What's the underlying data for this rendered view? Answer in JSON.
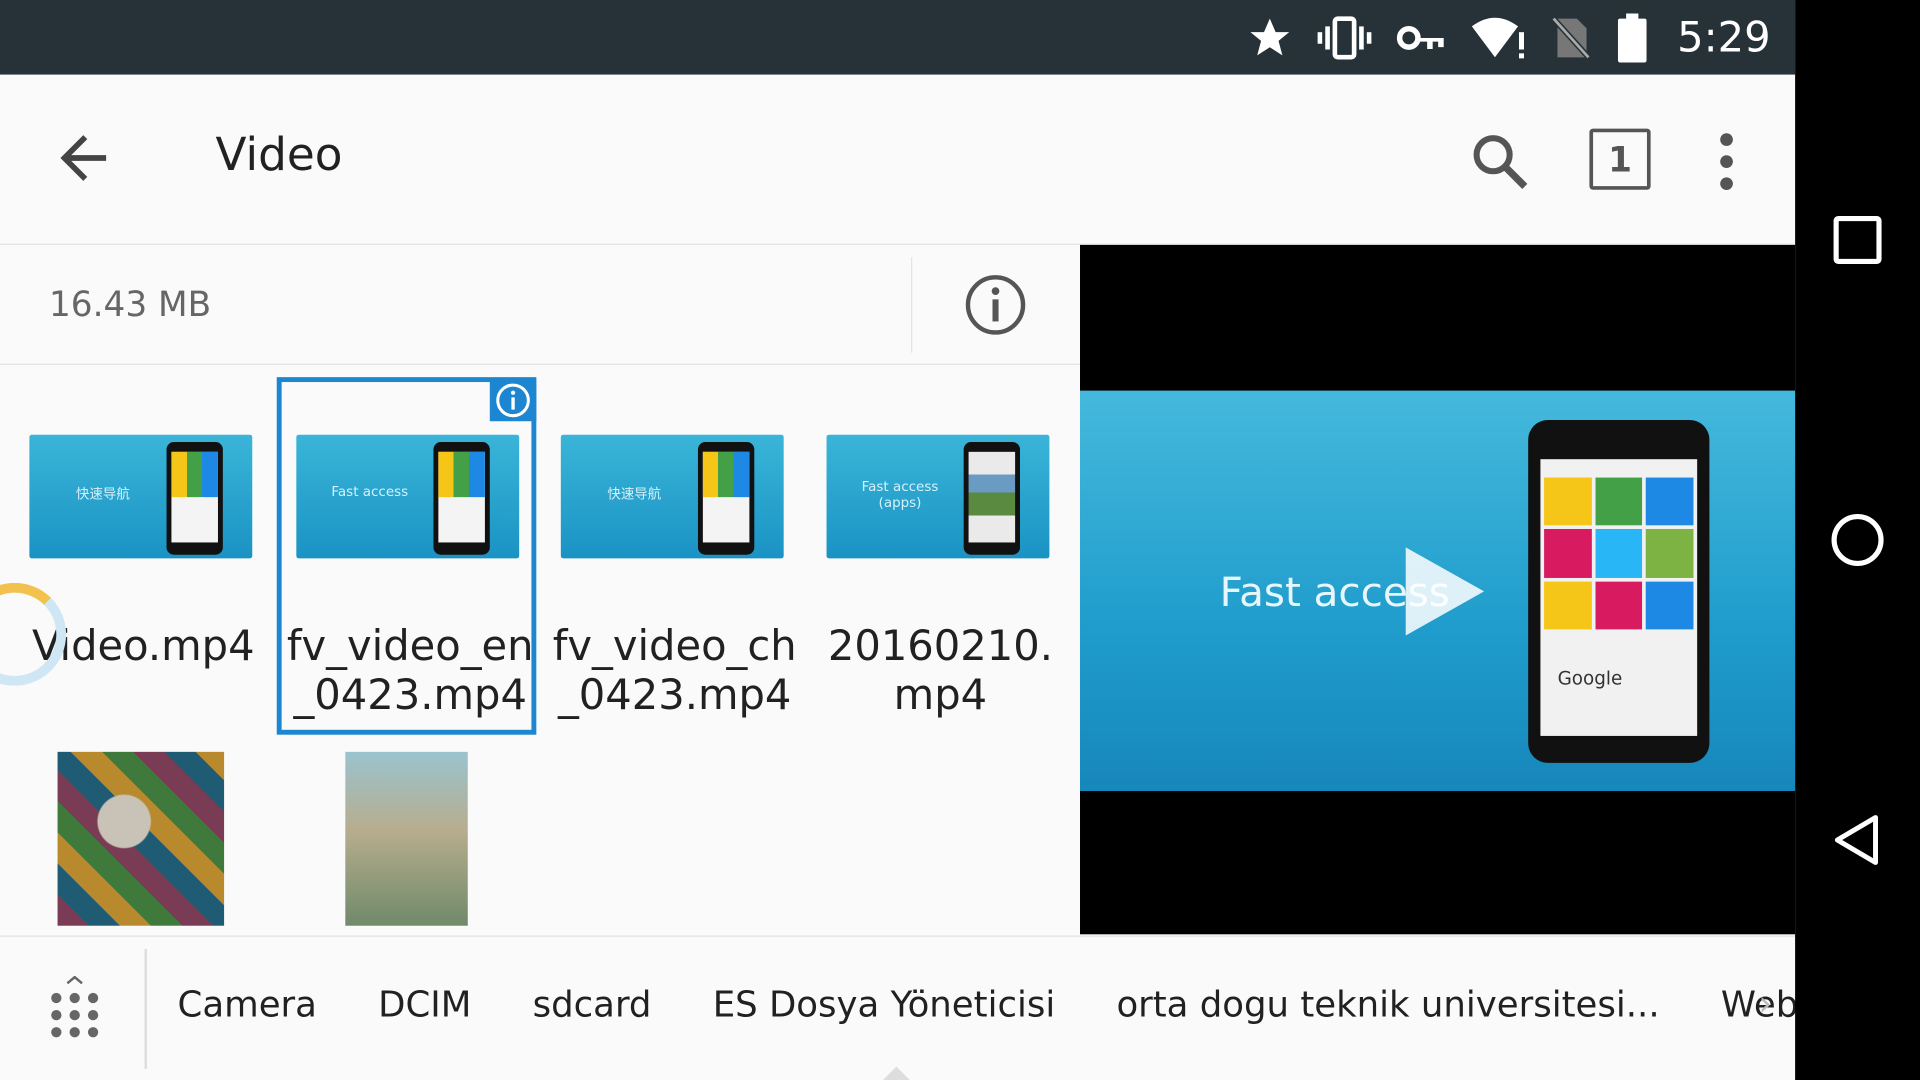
{
  "status_bar": {
    "time": "5:29",
    "icons": [
      "star-icon",
      "vibrate-icon",
      "vpn-key-icon",
      "wifi-alert-icon",
      "no-sim-icon",
      "battery-icon"
    ]
  },
  "toolbar": {
    "title": "Video",
    "window_count": "1"
  },
  "info": {
    "total_size": "16.43 MB"
  },
  "files": [
    {
      "name": "Video.mp4",
      "thumb_text": "快速导航"
    },
    {
      "name": "fv_video_en\n_0423.mp4",
      "thumb_text": "Fast access",
      "selected": true
    },
    {
      "name": "fv_video_ch\n_0423.mp4",
      "thumb_text": "快速导航"
    },
    {
      "name": "20160210.\nmp4",
      "thumb_text": "Fast access\n(apps)"
    }
  ],
  "preview": {
    "overlay_text": "Fast access",
    "phone_label": "Google"
  },
  "bottom_shortcuts": [
    "Camera",
    "DCIM",
    "sdcard",
    "ES Dosya Yöneticisi",
    "orta dogu teknik universitesi...",
    "Web sayf"
  ],
  "colors": {
    "status_bar": "#263238",
    "accent": "#1c86d1",
    "background": "#fafafa"
  }
}
